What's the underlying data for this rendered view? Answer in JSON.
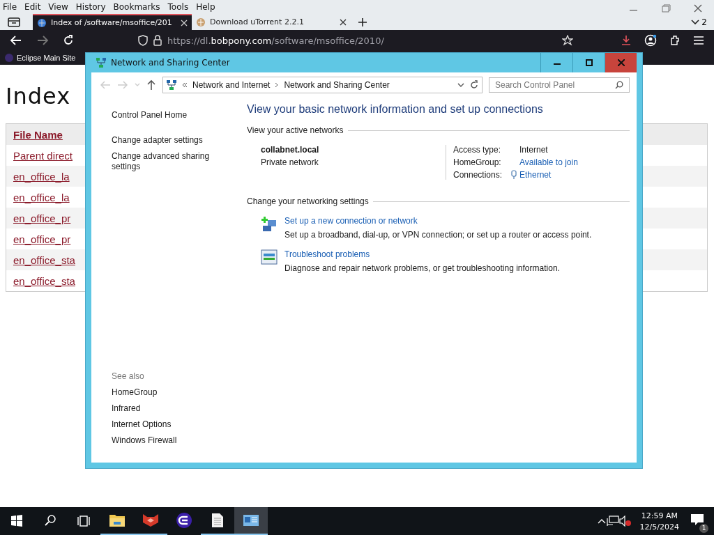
{
  "browser": {
    "menu": [
      "File",
      "Edit",
      "View",
      "History",
      "Bookmarks",
      "Tools",
      "Help"
    ],
    "tabs": [
      {
        "title": "Index of /software/msoffice/201",
        "selected": true
      },
      {
        "title": "Download uTorrent 2.2.1",
        "selected": false
      }
    ],
    "tab_count": "2",
    "url": {
      "scheme": "https://dl.",
      "domain": "bobpony.com",
      "path": "/software/msoffice/2010/"
    },
    "bookmarks": [
      "Eclipse Main Site"
    ]
  },
  "page": {
    "heading": "Index",
    "columns": [
      "File Name"
    ],
    "rows": [
      "Parent direct",
      "en_office_la",
      "en_office_la",
      "en_office_pr",
      "en_office_pr",
      "en_office_sta",
      "en_office_sta"
    ]
  },
  "window": {
    "title": "Network and Sharing Center",
    "breadcrumb": [
      "Network and Internet",
      "Network and Sharing Center"
    ],
    "search": {
      "placeholder": "Search Control Panel"
    },
    "sidebar": {
      "links": [
        {
          "label": "Control Panel Home"
        },
        {
          "label": "Change adapter settings"
        },
        {
          "label": "Change advanced sharing settings"
        }
      ],
      "see_also_title": "See also",
      "see_also": [
        "HomeGroup",
        "Infrared",
        "Internet Options",
        "Windows Firewall"
      ]
    },
    "heading": "View your basic network information and set up connections",
    "active_networks_title": "View your active networks",
    "network": {
      "name": "collabnet.local",
      "type": "Private network",
      "props": [
        {
          "label": "Access type:",
          "value": "Internet",
          "kind": "text"
        },
        {
          "label": "HomeGroup:",
          "value": "Available to join",
          "kind": "link"
        },
        {
          "label": "Connections:",
          "value": "Ethernet",
          "kind": "ethernet"
        }
      ]
    },
    "settings_title": "Change your networking settings",
    "tasks": [
      {
        "kind": "setup",
        "title": "Set up a new connection or network",
        "desc": "Set up a broadband, dial-up, or VPN connection; or set up a router or access point."
      },
      {
        "kind": "troubleshoot",
        "title": "Troubleshoot problems",
        "desc": "Diagnose and repair network problems, or get troubleshooting information."
      }
    ]
  },
  "taskbar": {
    "apps": [
      {
        "kind": "folder",
        "running": true,
        "selected": false
      },
      {
        "kind": "red",
        "running": true,
        "selected": false
      },
      {
        "kind": "purple",
        "running": false,
        "selected": false
      },
      {
        "kind": "document",
        "running": true,
        "selected": false
      },
      {
        "kind": "control",
        "running": true,
        "selected": true
      }
    ],
    "time": "12:59 AM",
    "date": "12/5/2024",
    "notifications": "1"
  }
}
